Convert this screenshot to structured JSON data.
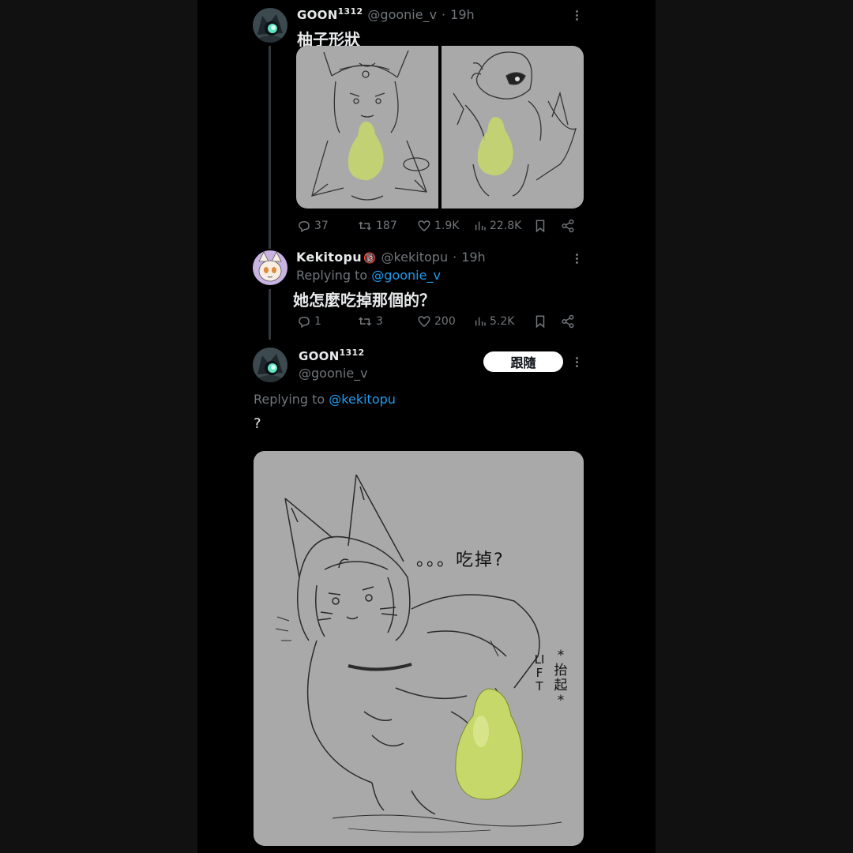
{
  "tweets": [
    {
      "display_name": "GOON",
      "display_sup": "1312",
      "handle": "@goonie_v",
      "time": "19h",
      "text": "柚子形狀",
      "stats": {
        "replies": "37",
        "retweets": "187",
        "likes": "1.9K",
        "views": "22.8K"
      }
    },
    {
      "display_name": "Kekitopu",
      "badge": "🔞",
      "handle": "@kekitopu",
      "time": "19h",
      "replying_prefix": "Replying to",
      "replying_to": "@goonie_v",
      "text": "她怎麼吃掉那個的？",
      "stats": {
        "replies": "1",
        "retweets": "3",
        "likes": "200",
        "views": "5.2K"
      }
    },
    {
      "display_name": "GOON",
      "display_sup": "1312",
      "handle": "@goonie_v",
      "follow_label": "跟隨",
      "replying_prefix": "Replying to",
      "replying_to": "@kekitopu",
      "text": "?",
      "drawing_caption": "。。。吃掉?",
      "drawing_side_label": "*抬起*",
      "drawing_lift_label": "LIFT"
    }
  ],
  "meta_sep": "·",
  "colors": {
    "background": "#000000",
    "text": "#e7e9ea",
    "muted": "#71767b",
    "link": "#1d9bf0",
    "image_bg": "#a9a9a9",
    "pomelo": "#c7d86a"
  },
  "icons": [
    "reply-icon",
    "retweet-icon",
    "like-icon",
    "views-icon",
    "bookmark-icon",
    "share-icon",
    "more-icon"
  ]
}
